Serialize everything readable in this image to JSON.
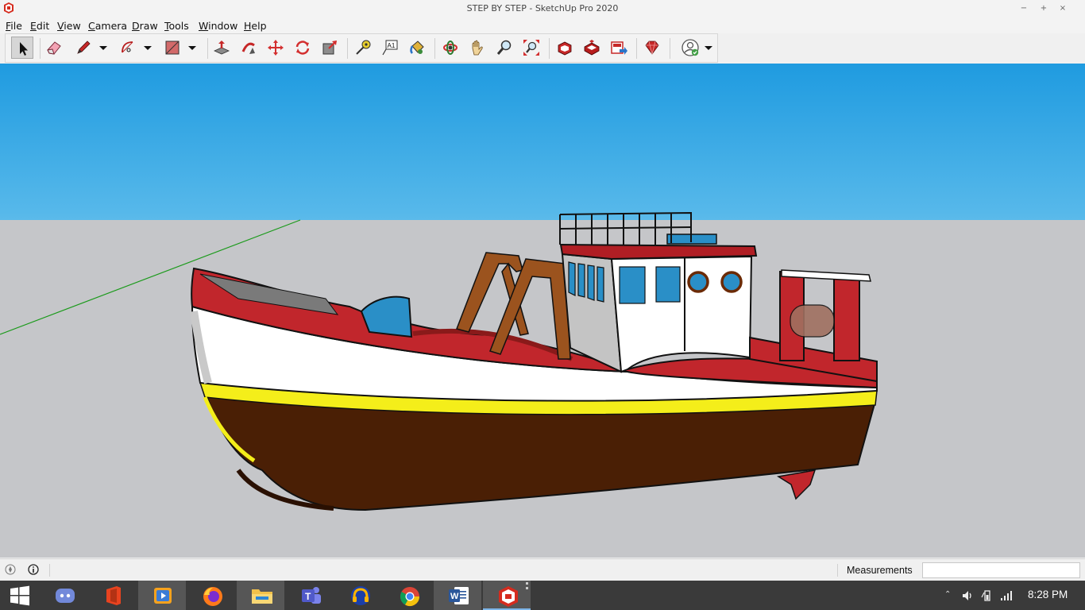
{
  "window": {
    "title": "STEP BY STEP - SketchUp Pro 2020",
    "minimize": "−",
    "maximize": "+",
    "close": "×"
  },
  "menu": [
    {
      "key": "F",
      "rest": "ile"
    },
    {
      "key": "E",
      "rest": "dit"
    },
    {
      "key": "V",
      "rest": "iew"
    },
    {
      "key": "C",
      "rest": "amera"
    },
    {
      "key": "D",
      "rest": "raw"
    },
    {
      "key": "T",
      "rest": "ools"
    },
    {
      "key": "W",
      "rest": "indow"
    },
    {
      "key": "H",
      "rest": "elp"
    }
  ],
  "toolbar": {
    "tools": [
      "select-icon",
      "eraser-icon",
      "pencil-icon",
      "arc-icon",
      "rectangle-icon",
      "push-pull-icon",
      "follow-me-icon",
      "move-icon",
      "rotate-icon",
      "scale-icon",
      "tape-measure-icon",
      "text-icon",
      "paint-bucket-icon",
      "orbit-icon",
      "pan-icon",
      "zoom-icon",
      "zoom-extents-icon",
      "warehouse-icon",
      "extension-warehouse-icon",
      "send-to-layout-icon",
      "ruby-console-icon",
      "account-icon"
    ],
    "text_tool_glyph": "A1"
  },
  "statusbar": {
    "measurements_label": "Measurements",
    "measurements_value": ""
  },
  "taskbar": {
    "apps": [
      "discord-icon",
      "office-icon",
      "video-icon",
      "firefox-icon",
      "file-explorer-icon",
      "teams-icon",
      "audio-icon",
      "chrome-icon",
      "word-icon",
      "sketchup-icon"
    ],
    "word_glyph": "W",
    "teams_glyph": "T",
    "clock": "8:28 PM"
  },
  "colors": {
    "sky_top": "#1f9be0",
    "ground": "#c5c6c9",
    "hull_red": "#c1262c",
    "hull_white": "#ffffff",
    "stripe_yellow": "#f4ee1a",
    "hull_brown": "#4a1f05",
    "cabin_blue": "#2a8fc7",
    "frame_wood": "#9b531e"
  }
}
